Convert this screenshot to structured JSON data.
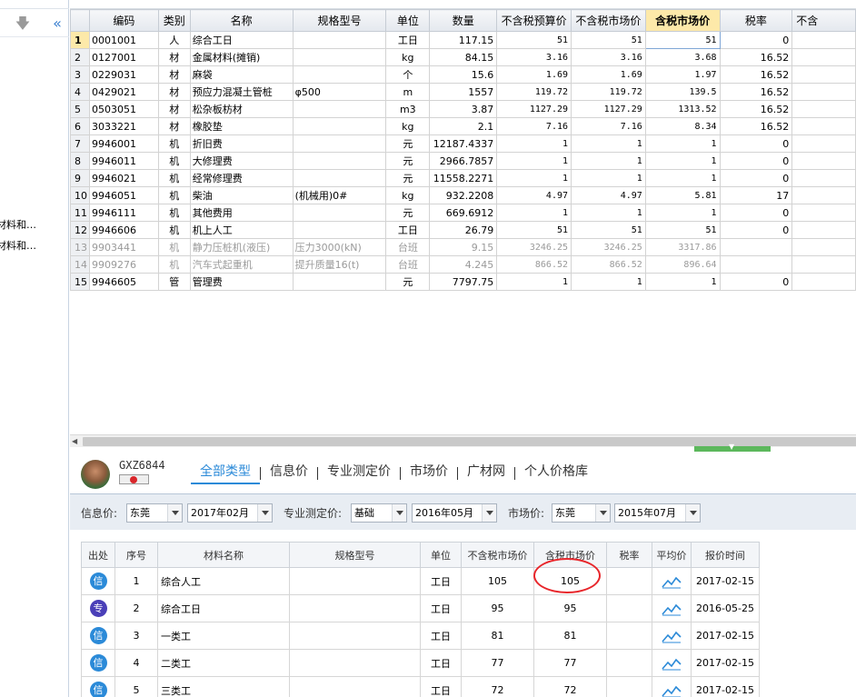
{
  "left_panel": {
    "tree_items": [
      "材料和…",
      "材料和…"
    ]
  },
  "grid": {
    "headers": [
      "编码",
      "类别",
      "名称",
      "规格型号",
      "单位",
      "数量",
      "不含税预算价",
      "不含税市场价",
      "含税市场价",
      "税率",
      "不含"
    ],
    "active_header": "含税市场价",
    "rows": [
      {
        "no": "1",
        "code": "0001001",
        "type": "人",
        "name": "综合工日",
        "spec": "",
        "unit": "工日",
        "qty": "117.15",
        "budget": "51",
        "market": "51",
        "tax_market": "51",
        "rate": "0",
        "gray": false
      },
      {
        "no": "2",
        "code": "0127001",
        "type": "材",
        "name": "金属材料(摊销)",
        "spec": "",
        "unit": "kg",
        "qty": "84.15",
        "budget": "3.16",
        "market": "3.16",
        "tax_market": "3.68",
        "rate": "16.52",
        "gray": false
      },
      {
        "no": "3",
        "code": "0229031",
        "type": "材",
        "name": "麻袋",
        "spec": "",
        "unit": "个",
        "qty": "15.6",
        "budget": "1.69",
        "market": "1.69",
        "tax_market": "1.97",
        "rate": "16.52",
        "gray": false
      },
      {
        "no": "4",
        "code": "0429021",
        "type": "材",
        "name": "预应力混凝土管桩",
        "spec": "φ500",
        "unit": "m",
        "qty": "1557",
        "budget": "119.72",
        "market": "119.72",
        "tax_market": "139.5",
        "rate": "16.52",
        "gray": false
      },
      {
        "no": "5",
        "code": "0503051",
        "type": "材",
        "name": "松杂板枋材",
        "spec": "",
        "unit": "m3",
        "qty": "3.87",
        "budget": "1127.29",
        "market": "1127.29",
        "tax_market": "1313.52",
        "rate": "16.52",
        "gray": false
      },
      {
        "no": "6",
        "code": "3033221",
        "type": "材",
        "name": "橡胶垫",
        "spec": "",
        "unit": "kg",
        "qty": "2.1",
        "budget": "7.16",
        "market": "7.16",
        "tax_market": "8.34",
        "rate": "16.52",
        "gray": false
      },
      {
        "no": "7",
        "code": "9946001",
        "type": "机",
        "name": "折旧费",
        "spec": "",
        "unit": "元",
        "qty": "12187.4337",
        "budget": "1",
        "market": "1",
        "tax_market": "1",
        "rate": "0",
        "gray": false
      },
      {
        "no": "8",
        "code": "9946011",
        "type": "机",
        "name": "大修理费",
        "spec": "",
        "unit": "元",
        "qty": "2966.7857",
        "budget": "1",
        "market": "1",
        "tax_market": "1",
        "rate": "0",
        "gray": false
      },
      {
        "no": "9",
        "code": "9946021",
        "type": "机",
        "name": "经常修理费",
        "spec": "",
        "unit": "元",
        "qty": "11558.2271",
        "budget": "1",
        "market": "1",
        "tax_market": "1",
        "rate": "0",
        "gray": false
      },
      {
        "no": "10",
        "code": "9946051",
        "type": "机",
        "name": "柴油",
        "spec": "(机械用)0#",
        "unit": "kg",
        "qty": "932.2208",
        "budget": "4.97",
        "market": "4.97",
        "tax_market": "5.81",
        "rate": "17",
        "gray": false
      },
      {
        "no": "11",
        "code": "9946111",
        "type": "机",
        "name": "其他费用",
        "spec": "",
        "unit": "元",
        "qty": "669.6912",
        "budget": "1",
        "market": "1",
        "tax_market": "1",
        "rate": "0",
        "gray": false
      },
      {
        "no": "12",
        "code": "9946606",
        "type": "机",
        "name": "机上人工",
        "spec": "",
        "unit": "工日",
        "qty": "26.79",
        "budget": "51",
        "market": "51",
        "tax_market": "51",
        "rate": "0",
        "gray": false
      },
      {
        "no": "13",
        "code": "9903441",
        "type": "机",
        "name": "静力压桩机(液压)",
        "spec": "压力3000(kN)",
        "unit": "台班",
        "qty": "9.15",
        "budget": "3246.25",
        "market": "3246.25",
        "tax_market": "3317.86",
        "rate": "",
        "gray": true
      },
      {
        "no": "14",
        "code": "9909276",
        "type": "机",
        "name": "汽车式起重机",
        "spec": "提升质量16(t)",
        "unit": "台班",
        "qty": "4.245",
        "budget": "866.52",
        "market": "866.52",
        "tax_market": "896.64",
        "rate": "",
        "gray": true
      },
      {
        "no": "15",
        "code": "9946605",
        "type": "管",
        "name": "管理费",
        "spec": "",
        "unit": "元",
        "qty": "7797.75",
        "budget": "1",
        "market": "1",
        "tax_market": "1",
        "rate": "0",
        "gray": false
      }
    ]
  },
  "user": {
    "name": "GXZ6844"
  },
  "price_tabs": [
    "全部类型",
    "信息价",
    "专业测定价",
    "市场价",
    "广材网",
    "个人价格库"
  ],
  "active_price_tab": "全部类型",
  "filters": {
    "info_label": "信息价:",
    "info_region": "东莞",
    "info_period": "2017年02月",
    "pro_label": "专业测定价:",
    "pro_base": "基础",
    "pro_period": "2016年05月",
    "market_label": "市场价:",
    "market_region": "东莞",
    "market_period": "2015年07月"
  },
  "price_grid": {
    "headers": [
      "出处",
      "序号",
      "材料名称",
      "规格型号",
      "单位",
      "不含税市场价",
      "含税市场价",
      "税率",
      "平均价",
      "报价时间"
    ],
    "rows": [
      {
        "source": "信",
        "source_type": "info",
        "no": "1",
        "name": "综合人工",
        "spec": "",
        "unit": "工日",
        "price": "105",
        "tax_price": "105",
        "rate": "",
        "date": "2017-02-15"
      },
      {
        "source": "专",
        "source_type": "pro",
        "no": "2",
        "name": "综合工日",
        "spec": "",
        "unit": "工日",
        "price": "95",
        "tax_price": "95",
        "rate": "",
        "date": "2016-05-25"
      },
      {
        "source": "信",
        "source_type": "info",
        "no": "3",
        "name": "一类工",
        "spec": "",
        "unit": "工日",
        "price": "81",
        "tax_price": "81",
        "rate": "",
        "date": "2017-02-15"
      },
      {
        "source": "信",
        "source_type": "info",
        "no": "4",
        "name": "二类工",
        "spec": "",
        "unit": "工日",
        "price": "77",
        "tax_price": "77",
        "rate": "",
        "date": "2017-02-15"
      },
      {
        "source": "信",
        "source_type": "info",
        "no": "5",
        "name": "三类工",
        "spec": "",
        "unit": "工日",
        "price": "72",
        "tax_price": "72",
        "rate": "",
        "date": "2017-02-15"
      }
    ]
  },
  "colors": {
    "accent": "#2b8ad8",
    "header_active": "#fde9a9",
    "highlight": "#e8262b",
    "splitter": "#5cb85c"
  },
  "icons": {
    "down": "arrow-down-icon",
    "collapse": "double-chevron-left-icon",
    "trend": "trend-chart-icon"
  }
}
